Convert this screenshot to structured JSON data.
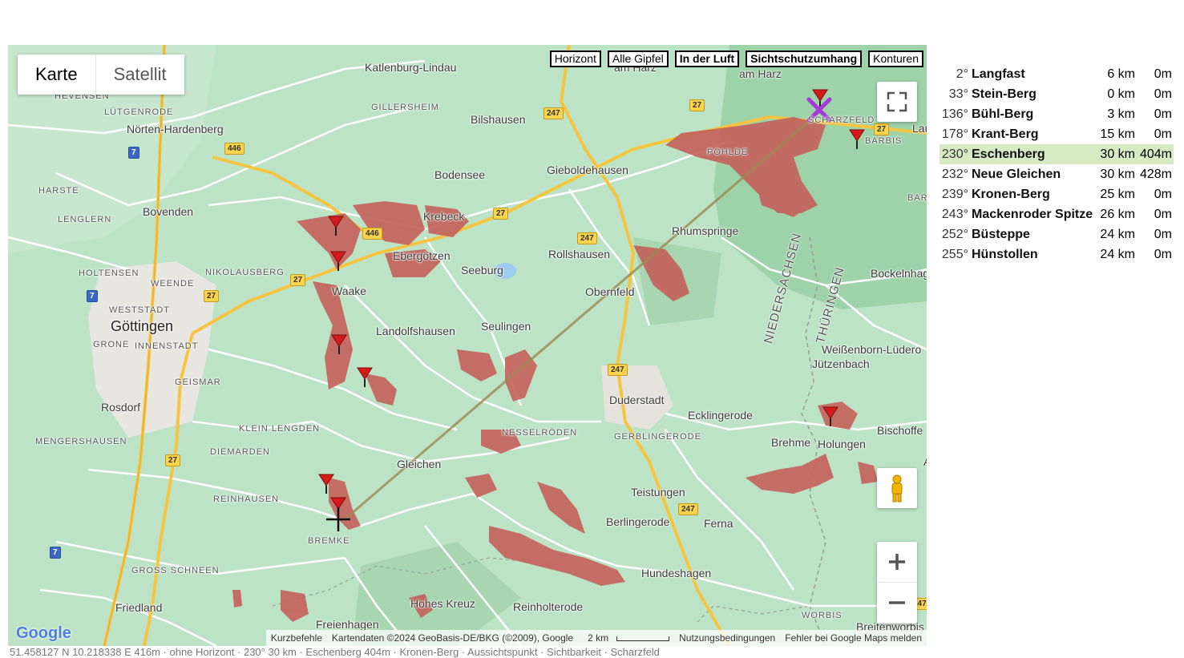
{
  "map_type": {
    "karte": "Karte",
    "satellit": "Satellit"
  },
  "toggles": [
    {
      "label": "Horizont",
      "bold": false
    },
    {
      "label": "Alle Gipfel",
      "bold": false
    },
    {
      "label": "In der Luft",
      "bold": true
    },
    {
      "label": "Sichtschutzumhang",
      "bold": true
    },
    {
      "label": "Konturen",
      "bold": false
    }
  ],
  "places": [
    {
      "name": "Katlenburg-Lindau",
      "cls": ""
    },
    {
      "name": "HEVENSEN",
      "cls": "small"
    },
    {
      "name": "LÜTGENRODE",
      "cls": "small"
    },
    {
      "name": "Nörten-Hardenberg",
      "cls": ""
    },
    {
      "name": "GILLERSHEIM",
      "cls": "small"
    },
    {
      "name": "Bilshausen",
      "cls": ""
    },
    {
      "name": "am Harz",
      "cls": ""
    },
    {
      "name": "am Harz",
      "cls": ""
    },
    {
      "name": "SCHARZFELD",
      "cls": "small"
    },
    {
      "name": "BARBIS",
      "cls": "small"
    },
    {
      "name": "POHLDE",
      "cls": "small"
    },
    {
      "name": "Bodensee",
      "cls": ""
    },
    {
      "name": "Gieboldehausen",
      "cls": ""
    },
    {
      "name": "HARSTE",
      "cls": "small"
    },
    {
      "name": "Bovenden",
      "cls": ""
    },
    {
      "name": "Krebeck",
      "cls": ""
    },
    {
      "name": "LENGLERN",
      "cls": "small"
    },
    {
      "name": "Rhumspringe",
      "cls": ""
    },
    {
      "name": "Ebergötzen",
      "cls": ""
    },
    {
      "name": "Rollshausen",
      "cls": ""
    },
    {
      "name": "HOLTENSEN",
      "cls": "small"
    },
    {
      "name": "NIKOLAUSBERG",
      "cls": "small"
    },
    {
      "name": "Seeburg",
      "cls": ""
    },
    {
      "name": "WEENDE",
      "cls": "small"
    },
    {
      "name": "Waake",
      "cls": ""
    },
    {
      "name": "Obernfeld",
      "cls": ""
    },
    {
      "name": "Bockelnhagen",
      "cls": ""
    },
    {
      "name": "WESTSTADT",
      "cls": "small"
    },
    {
      "name": "Göttingen",
      "cls": "city"
    },
    {
      "name": "Landolfshausen",
      "cls": ""
    },
    {
      "name": "Seulingen",
      "cls": ""
    },
    {
      "name": "GRONE",
      "cls": "small"
    },
    {
      "name": "INNENSTADT",
      "cls": "small"
    },
    {
      "name": "Weißenborn-Lüdero",
      "cls": ""
    },
    {
      "name": "GEISMAR",
      "cls": "small"
    },
    {
      "name": "Jützenbach",
      "cls": ""
    },
    {
      "name": "Duderstadt",
      "cls": ""
    },
    {
      "name": "Rosdorf",
      "cls": ""
    },
    {
      "name": "Ecklingerode",
      "cls": ""
    },
    {
      "name": "KLEIN LENGDEN",
      "cls": "small"
    },
    {
      "name": "Bischoffe",
      "cls": ""
    },
    {
      "name": "NESSELRÖDEN",
      "cls": "small"
    },
    {
      "name": "GERBLINGERODE",
      "cls": "small"
    },
    {
      "name": "MENGERSHAUSEN",
      "cls": "small"
    },
    {
      "name": "Brehme",
      "cls": ""
    },
    {
      "name": "Holungen",
      "cls": ""
    },
    {
      "name": "DIEMARDEN",
      "cls": "small"
    },
    {
      "name": "Gleichen",
      "cls": ""
    },
    {
      "name": "Am",
      "cls": ""
    },
    {
      "name": "REINHAUSEN",
      "cls": "small"
    },
    {
      "name": "Teistungen",
      "cls": ""
    },
    {
      "name": "Ferna",
      "cls": ""
    },
    {
      "name": "Berlingerode",
      "cls": ""
    },
    {
      "name": "BREMKE",
      "cls": "small"
    },
    {
      "name": "GROSS SCHNEEN",
      "cls": "small"
    },
    {
      "name": "Hundeshagen",
      "cls": ""
    },
    {
      "name": "Hohes Kreuz",
      "cls": ""
    },
    {
      "name": "Reinholterode",
      "cls": ""
    },
    {
      "name": "Friedland",
      "cls": ""
    },
    {
      "name": "Freienhagen",
      "cls": ""
    },
    {
      "name": "WORBIS",
      "cls": "small"
    },
    {
      "name": "Breitenworbis",
      "cls": ""
    },
    {
      "name": "NIEDERSACHSEN",
      "cls": "region"
    },
    {
      "name": "THÜRINGEN",
      "cls": "region"
    },
    {
      "name": "Lau",
      "cls": ""
    },
    {
      "name": "BAR",
      "cls": "small"
    }
  ],
  "road_shields": [
    "247",
    "27",
    "7",
    "446",
    "27",
    "446",
    "27",
    "247",
    "27",
    "7",
    "27",
    "247",
    "247",
    "7",
    "27",
    "247"
  ],
  "attribution": {
    "shortcuts": "Kurzbefehle",
    "data": "Kartendaten ©2024 GeoBasis-DE/BKG (©2009), Google",
    "scale": "2 km",
    "terms": "Nutzungsbedingungen",
    "report": "Fehler bei Google Maps melden",
    "google": "Google"
  },
  "peaks": [
    {
      "azimuth": "2°",
      "name": "Langfast",
      "distance": "6 km",
      "height": "0m",
      "highlight": false
    },
    {
      "azimuth": "33°",
      "name": "Stein-Berg",
      "distance": "0 km",
      "height": "0m",
      "highlight": false
    },
    {
      "azimuth": "136°",
      "name": "Bühl-Berg",
      "distance": "3 km",
      "height": "0m",
      "highlight": false
    },
    {
      "azimuth": "178°",
      "name": "Krant-Berg",
      "distance": "15 km",
      "height": "0m",
      "highlight": false
    },
    {
      "azimuth": "230°",
      "name": "Eschenberg",
      "distance": "30 km",
      "height": "404m",
      "highlight": true
    },
    {
      "azimuth": "232°",
      "name": "Neue Gleichen",
      "distance": "30 km",
      "height": "428m",
      "highlight": false
    },
    {
      "azimuth": "239°",
      "name": "Kronen-Berg",
      "distance": "25 km",
      "height": "0m",
      "highlight": false
    },
    {
      "azimuth": "243°",
      "name": "Mackenroder Spitze",
      "distance": "26 km",
      "height": "0m",
      "highlight": false
    },
    {
      "azimuth": "252°",
      "name": "Büsteppe",
      "distance": "24 km",
      "height": "0m",
      "highlight": false
    },
    {
      "azimuth": "255°",
      "name": "Hünstollen",
      "distance": "24 km",
      "height": "0m",
      "highlight": false
    }
  ],
  "bottom_line": "51.458127 N 10.218338 E 416m · ohne Horizont · 230° 30 km · Eschenberg 404m · Kronen-Berg · Aussichtspunkt · Sichtbarkeit · Scharzfeld",
  "colors": {
    "map_bg": "#b9dfc2",
    "visibility": "#c4645c",
    "marker": "#d31b1b",
    "highlight": "#d6ebc4",
    "sight_line": "#9c8a52"
  }
}
